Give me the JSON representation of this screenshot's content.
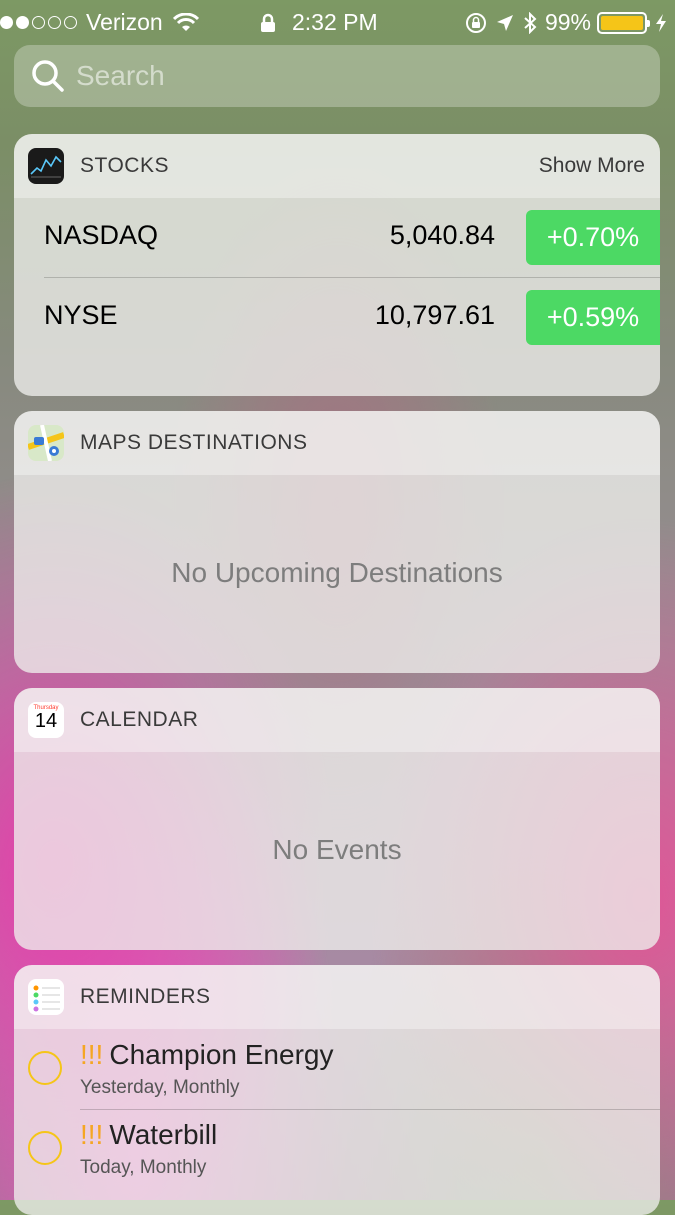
{
  "status_bar": {
    "carrier": "Verizon",
    "time": "2:32 PM",
    "battery": "99%",
    "battery_level": 0.99,
    "signal_bars_filled": 2,
    "signal_bars_total": 5
  },
  "search": {
    "placeholder": "Search"
  },
  "stocks": {
    "title": "STOCKS",
    "show_more": "Show More",
    "rows": [
      {
        "name": "NASDAQ",
        "price": "5,040.84",
        "change": "+0.70%"
      },
      {
        "name": "NYSE",
        "price": "10,797.61",
        "change": "+0.59%"
      }
    ],
    "accent": "#4cd964"
  },
  "maps": {
    "title": "MAPS DESTINATIONS",
    "empty": "No Upcoming Destinations"
  },
  "calendar": {
    "title": "CALENDAR",
    "icon_weekday": "Thursday",
    "icon_day": "14",
    "empty": "No Events"
  },
  "reminders": {
    "title": "REMINDERS",
    "items": [
      {
        "priority": "!!!",
        "title": "Champion Energy",
        "subtitle": "Yesterday, Monthly"
      },
      {
        "priority": "!!!",
        "title": "Waterbill",
        "subtitle": "Today, Monthly"
      }
    ]
  }
}
